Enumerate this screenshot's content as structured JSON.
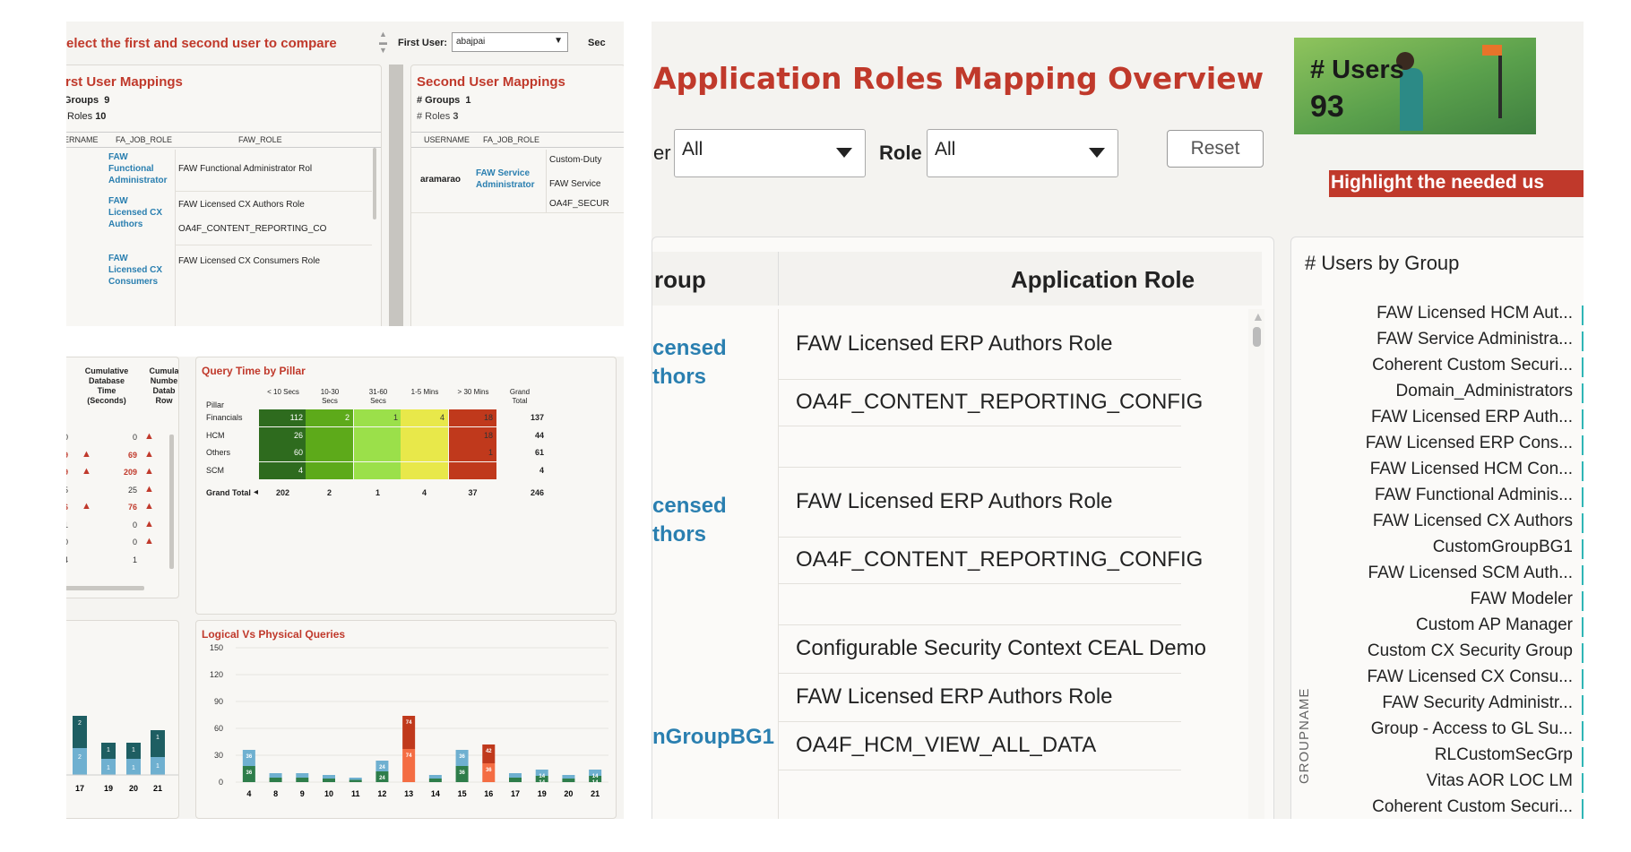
{
  "left": {
    "compare_prompt": "elect the first and second user to compare",
    "first_user_label": "First User:",
    "first_user_value": "abajpai",
    "second_user_label_cut": "Sec",
    "first_mappings": {
      "title": "rst User Mappings",
      "groups_label": "Groups",
      "groups_value": "9",
      "roles_label": "Roles",
      "roles_value": "10",
      "col_username": "ERNAME",
      "col_job_role": "FA_JOB_ROLE",
      "col_faw_role": "FAW_ROLE",
      "rows": [
        {
          "job": "FAW\nFunctional\nAdministrator",
          "roles": [
            "FAW Functional Administrator Rol"
          ]
        },
        {
          "job": "FAW\nLicensed CX\nAuthors",
          "roles": [
            "FAW Licensed CX Authors Role",
            "OA4F_CONTENT_REPORTING_CO"
          ]
        },
        {
          "job": "FAW\nLicensed CX\nConsumers",
          "roles": [
            "FAW Licensed CX Consumers Role"
          ]
        }
      ]
    },
    "second_mappings": {
      "title": "Second User Mappings",
      "groups_label": "# Groups",
      "groups_value": "1",
      "roles_label": "# Roles",
      "roles_value": "3",
      "col_username": "USERNAME",
      "col_job_role": "FA_JOB_ROLE",
      "username": "aramarao",
      "job": "FAW Service\nAdministrator",
      "roles": [
        "Custom-Duty",
        "FAW Service",
        "OA4F_SECUR"
      ]
    },
    "cumulative": {
      "col1": ")",
      "col2": "Cumulative\nDatabase\nTime\n(Seconds)",
      "col3": "Cumula\nNumbe\nDatab\nRow",
      "rows": [
        {
          "a": "0",
          "b": "0",
          "up1": false,
          "up2": true,
          "red": false
        },
        {
          "a": "9",
          "b": "69",
          "up1": true,
          "up2": true,
          "red": true
        },
        {
          "a": "9",
          "b": "209",
          "up1": true,
          "up2": true,
          "red": true
        },
        {
          "a": "5",
          "b": "25",
          "up1": false,
          "up2": true,
          "red": false
        },
        {
          "a": "6",
          "b": "76",
          "up1": true,
          "up2": true,
          "red": true
        },
        {
          "a": "1",
          "b": "0",
          "up1": false,
          "up2": true,
          "red": false
        },
        {
          "a": "0",
          "b": "0",
          "up1": false,
          "up2": true,
          "red": false
        },
        {
          "a": "4",
          "b": "1",
          "up1": false,
          "up2": false,
          "red": false
        }
      ]
    },
    "query_time": {
      "title": "Query Time by Pillar",
      "pillar_label": "Pillar",
      "headers": [
        "< 10 Secs",
        "10-30\nSecs",
        "31-60\nSecs",
        "1-5 Mins",
        "> 30 Mins",
        "Grand\nTotal"
      ],
      "rows": [
        {
          "name": "Financials",
          "values": [
            "112",
            "2",
            "1",
            "4",
            "18"
          ],
          "total": "137"
        },
        {
          "name": "HCM",
          "values": [
            "26",
            "",
            "",
            "",
            "18"
          ],
          "total": "44"
        },
        {
          "name": "Others",
          "values": [
            "60",
            "",
            "",
            "",
            "1"
          ],
          "total": "61"
        },
        {
          "name": "SCM",
          "values": [
            "4",
            "",
            "",
            "",
            ""
          ],
          "total": "4"
        }
      ],
      "grand_total_label": "Grand Total",
      "grand_totals": [
        "202",
        "2",
        "1",
        "4",
        "37",
        "246"
      ],
      "colors": [
        "#2e6b1e",
        "#5daa1a",
        "#9be04a",
        "#e8e84a",
        "#c0391c"
      ]
    },
    "mini_bars": {
      "x_labels": [
        "17",
        "19",
        "20",
        "21"
      ],
      "top_values": [
        "2",
        "1",
        "1",
        "1"
      ],
      "bottom_values": [
        "2",
        "1",
        "1",
        "1"
      ]
    }
  },
  "chart_data": {
    "type": "bar",
    "title": "Logical Vs Physical Queries",
    "categories": [
      "4",
      "8",
      "9",
      "10",
      "11",
      "12",
      "13",
      "14",
      "15",
      "16",
      "17",
      "19",
      "20",
      "21"
    ],
    "series": [
      {
        "values": [
          36,
          10,
          10,
          8,
          5,
          24,
          74,
          8,
          36,
          42,
          10,
          14,
          8,
          14
        ]
      },
      {
        "values": [
          0,
          0,
          0,
          0,
          0,
          0,
          74,
          0,
          0,
          36,
          0,
          0,
          0,
          0
        ]
      },
      {
        "values": [
          36,
          10,
          10,
          8,
          5,
          24,
          74,
          8,
          36,
          42,
          10,
          14,
          8,
          14
        ]
      }
    ],
    "y_ticks": [
      "0",
      "30",
      "60",
      "90",
      "120",
      "150"
    ],
    "ylim": [
      0,
      150
    ],
    "data_labels": {
      "4": [
        "36",
        "36"
      ],
      "12": [
        "24",
        "24"
      ],
      "13": [
        "74",
        "74"
      ],
      "15": [
        "36",
        "36"
      ],
      "16": [
        "42",
        "36"
      ],
      "19": [
        "14",
        "14"
      ],
      "21": [
        "14",
        "14"
      ]
    }
  },
  "right": {
    "title": "Application Roles Mapping Overview",
    "users_tile": {
      "label": "# Users",
      "value": "93"
    },
    "filter1_label_cut": "er",
    "filter1_value": "All",
    "role_label": "Role",
    "role_value": "All",
    "reset_label": "Reset",
    "highlight_banner": "Highlight the needed us",
    "table": {
      "col_group": "roup",
      "col_role": "Application Role",
      "groups": [
        {
          "name": "censed\nthors",
          "roles": [
            "FAW Licensed ERP Authors Role",
            "OA4F_CONTENT_REPORTING_CONFIG",
            ""
          ]
        },
        {
          "name": "censed\nthors",
          "roles": [
            "FAW Licensed ERP Authors Role",
            "OA4F_CONTENT_REPORTING_CONFIG",
            ""
          ]
        },
        {
          "name": "nGroupBG1",
          "roles": [
            "Configurable Security Context CEAL Demo",
            "FAW Licensed ERP Authors Role",
            "OA4F_HCM_VIEW_ALL_DATA"
          ]
        }
      ]
    },
    "users_by_group": {
      "title": "# Users by Group",
      "axis_label": "GROUPNAME",
      "groups": [
        "FAW Licensed HCM Aut...",
        "FAW Service Administra...",
        "Coherent Custom Securi...",
        "Domain_Administrators",
        "FAW Licensed ERP Auth...",
        "FAW Licensed ERP Cons...",
        "FAW Licensed HCM Con...",
        "FAW Functional Adminis...",
        "FAW Licensed CX Authors",
        "CustomGroupBG1",
        "FAW Licensed SCM Auth...",
        "FAW Modeler",
        "Custom AP Manager",
        "Custom CX Security Group",
        "FAW Licensed CX Consu...",
        "FAW Security Administr...",
        "Group - Access to GL Su...",
        "RLCustomSecGrp",
        "Vitas AOR LOC LM",
        "Coherent Custom Securi..."
      ]
    }
  }
}
